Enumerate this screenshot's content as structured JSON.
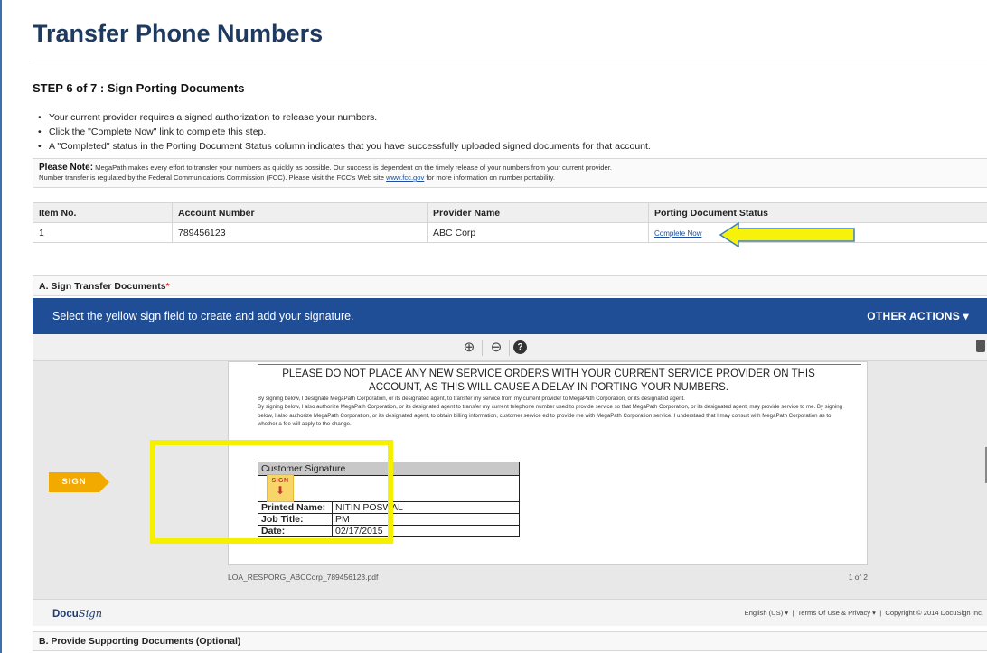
{
  "page": {
    "title": "Transfer Phone Numbers",
    "step": "STEP 6 of 7 : Sign Porting Documents",
    "bullets": [
      "Your current provider requires a signed authorization to release your numbers.",
      "Click the \"Complete Now\" link to complete this step.",
      "A \"Completed\" status in the Porting Document Status column indicates that you have successfully uploaded signed documents for that account."
    ]
  },
  "note": {
    "label": "Please Note:",
    "line1": "MegaPath makes every effort to transfer your numbers as quickly as possible. Our success is dependent on the timely release of your numbers from your current provider.",
    "line2_before": "Number transfer is regulated by the Federal Communications Commission (FCC). Please visit the FCC's Web site ",
    "link": "www.fcc.gov",
    "line2_after": " for more information on number portability."
  },
  "table": {
    "headers": [
      "Item No.",
      "Account Number",
      "Provider Name",
      "Porting Document Status"
    ],
    "row": {
      "item_no": "1",
      "account_number": "789456123",
      "provider_name": "ABC Corp",
      "status_link": "Complete Now"
    }
  },
  "section_a": {
    "title": "A. Sign Transfer Documents",
    "required_mark": "*"
  },
  "docusign": {
    "banner_message": "Select the yellow sign field to create and add your signature.",
    "other_actions": "OTHER ACTIONS ▾",
    "toolbar": {
      "zoom_in": "⊕",
      "zoom_out": "⊖",
      "help": "?"
    },
    "document": {
      "warning_line1": "PLEASE DO NOT PLACE ANY NEW SERVICE ORDERS WITH YOUR CURRENT SERVICE PROVIDER ON THIS",
      "warning_line2": "ACCOUNT, AS THIS WILL CAUSE A DELAY IN PORTING YOUR NUMBERS.",
      "body1": "By signing below, I designate MegaPath Corporation, or its designated agent, to transfer my service from my current provider to MegaPath Corporation, or its designated agent.",
      "body2": "By signing below, I also authorize MegaPath Corporation, or its designated agent to transfer my current telephone number used to provide service so that MegaPath Corporation, or its designated agent, may provide service to me. By signing below, I also authorize MegaPath Corporation, or its designated agent, to obtain billing information, customer service ed to provide me with MegaPath Corporation service. I understand that I may consult with MegaPath Corporation as to whether a fee will apply to the change.",
      "sig_heading": "Customer Signature",
      "sign_box_text": "SIGN",
      "sign_box_arrow": "⬇",
      "printed_name_label": "Printed Name:",
      "printed_name_value": "NITIN POSWAL",
      "job_title_label": "Job Title:",
      "job_title_value": "PM",
      "date_label": "Date:",
      "date_value": "02/17/2015"
    },
    "sign_tag": "SIGN",
    "filename": "LOA_RESPORG_ABCCorp_789456123.pdf",
    "page_indicator": "1 of 2",
    "logo_text": "Docu",
    "logo_script": "Sign",
    "footer_language": "English (US) ▾",
    "footer_terms": "Terms Of Use & Privacy ▾",
    "footer_copyright": "Copyright © 2014 DocuSign Inc."
  },
  "section_b": {
    "title": "B. Provide Supporting Documents (Optional)"
  },
  "colors": {
    "title": "#1e3a5f",
    "banner": "#1f4e96",
    "highlight_yellow": "#f5f000",
    "sign_tag": "#f2a900",
    "link": "#1a4fa0"
  }
}
